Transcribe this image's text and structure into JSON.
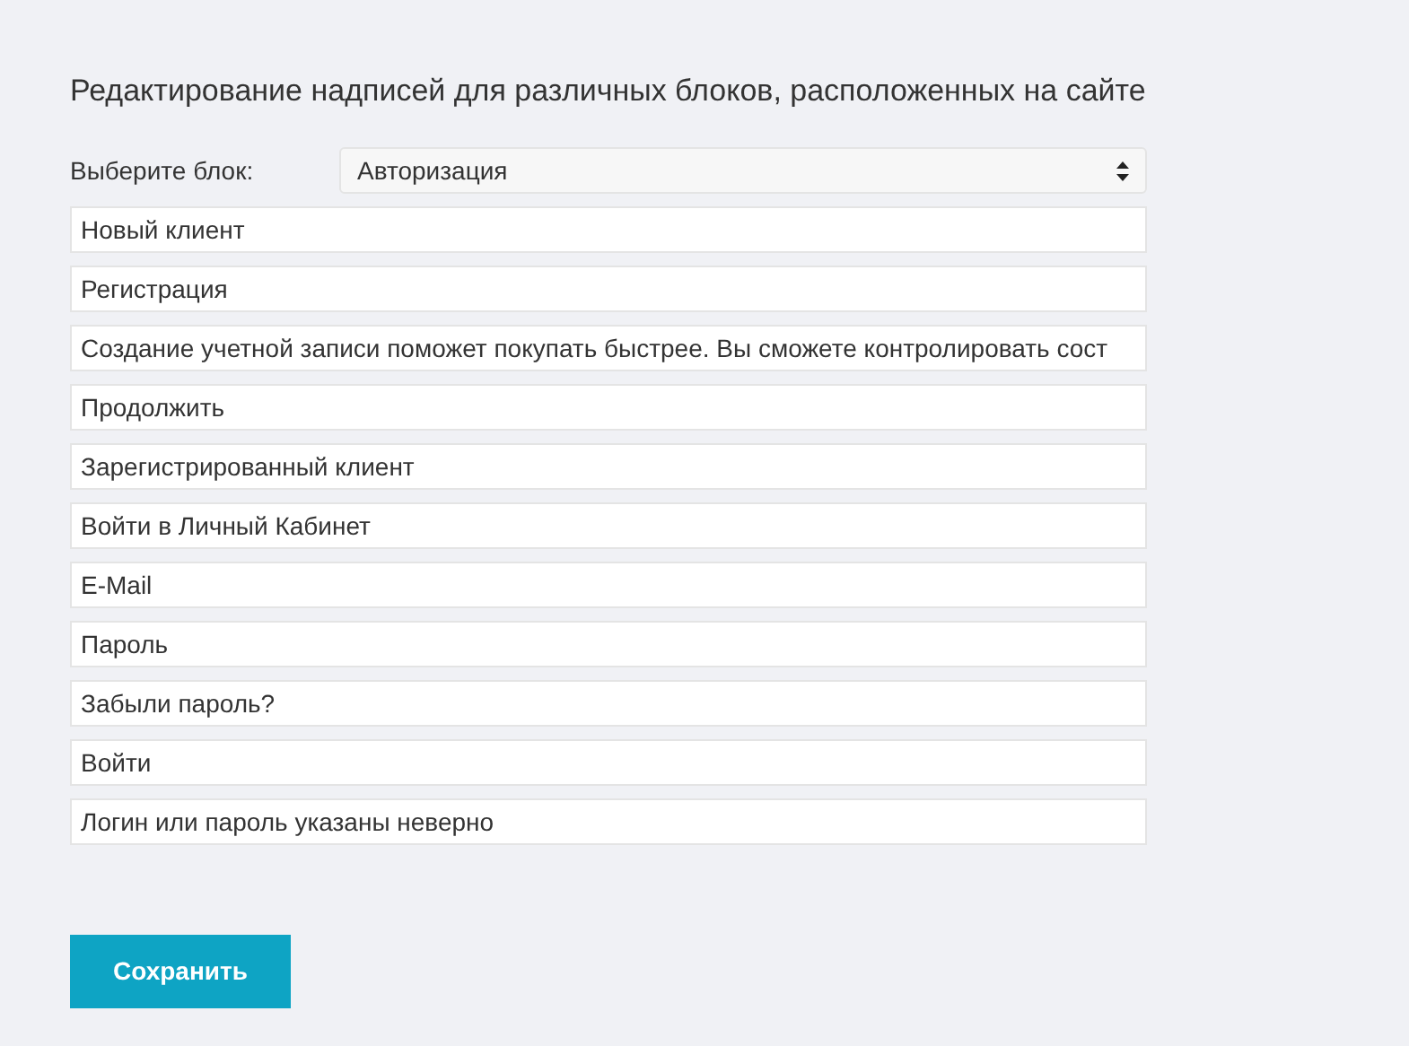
{
  "title": "Редактирование надписей для различных блоков, расположенных на сайте",
  "block_select": {
    "label": "Выберите блок:",
    "value": "Авторизация"
  },
  "fields": [
    {
      "value": "Новый клиент"
    },
    {
      "value": "Регистрация"
    },
    {
      "value": "Создание учетной записи поможет покупать быстрее. Вы сможете контролировать сост"
    },
    {
      "value": "Продолжить"
    },
    {
      "value": "Зарегистрированный клиент"
    },
    {
      "value": "Войти в Личный Кабинет"
    },
    {
      "value": "E-Mail"
    },
    {
      "value": "Пароль"
    },
    {
      "value": "Забыли пароль?"
    },
    {
      "value": "Войти"
    },
    {
      "value": "Логин или пароль указаны неверно"
    }
  ],
  "save_button": "Сохранить"
}
